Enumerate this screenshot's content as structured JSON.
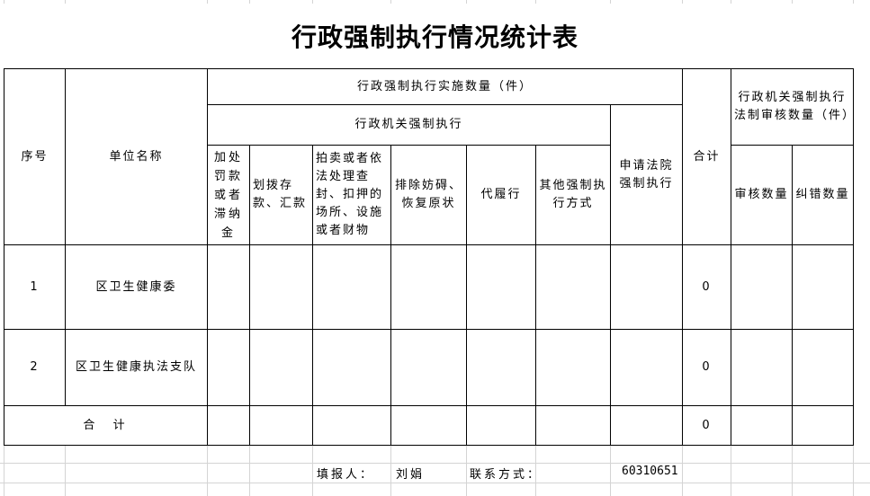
{
  "document": {
    "title": "行政强制执行情况统计表"
  },
  "table": {
    "headers": {
      "seq": "序号",
      "unit_name": "单位名称",
      "implementation_count": "行政强制执行实施数量（件）",
      "agency_enforcement": "行政机关强制执行",
      "sub_columns": [
        "加处罚款或者滞纳金",
        "划拨存款、汇款",
        "拍卖或者依法处理查封、扣押的场所、设施或者财物",
        "排除妨碍、恢复原状",
        "代履行",
        "其他强制执行方式"
      ],
      "court_application": "申请法院强制执行",
      "total": "合计",
      "legal_review": "行政机关强制执行法制审核数量（件）",
      "review_count": "审核数量",
      "correction_count": "纠错数量"
    },
    "rows": [
      {
        "seq": "1",
        "unit": "区卫生健康委",
        "total": "0"
      },
      {
        "seq": "2",
        "unit": "区卫生健康执法支队",
        "total": "0"
      }
    ],
    "sum_row": {
      "label": "合  计",
      "total": "0"
    }
  },
  "footer": {
    "filler_label": "填报人：",
    "filler_name": "刘娟",
    "contact_label": "联系方式：",
    "contact_value": "60310651"
  }
}
